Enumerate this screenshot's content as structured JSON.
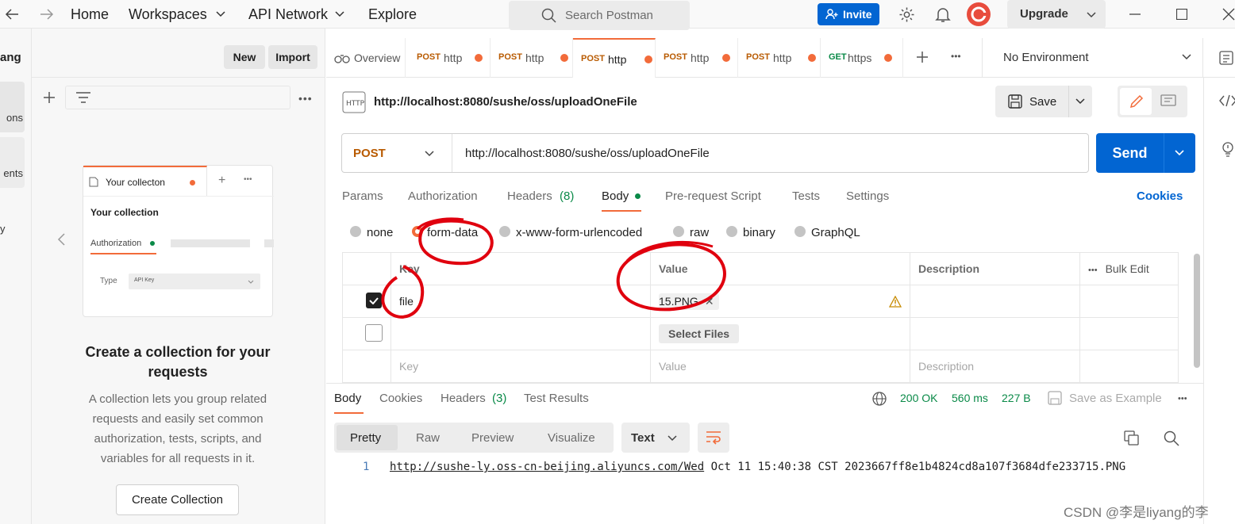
{
  "topbar": {
    "nav": [
      "Home",
      "Workspaces",
      "API Network",
      "Explore"
    ],
    "search_placeholder": "Search Postman",
    "invite_label": "Invite",
    "upgrade_label": "Upgrade"
  },
  "sidebar": {
    "workspace_name": "ang",
    "new_label": "New",
    "import_label": "Import",
    "rail_items": [
      "ons",
      "ents",
      "y"
    ],
    "illustration": {
      "tab_label": "Your collecton",
      "collection_title": "Your collection",
      "auth_label": "Authorization",
      "type_label": "Type",
      "type_value": "API Key"
    },
    "empty_title": "Create a collection for your requests",
    "empty_desc": "A collection lets you group related requests and easily set common authorization, tests, scripts, and variables for all requests in it.",
    "create_button": "Create Collection"
  },
  "tabs": [
    {
      "method": "",
      "label": "Overview"
    },
    {
      "method": "POST",
      "label": "http"
    },
    {
      "method": "POST",
      "label": "http"
    },
    {
      "method": "POST",
      "label": "http"
    },
    {
      "method": "POST",
      "label": "http"
    },
    {
      "method": "POST",
      "label": "http"
    },
    {
      "method": "GET",
      "label": "https"
    }
  ],
  "environment": "No Environment",
  "request": {
    "title_url": "http://localhost:8080/sushe/oss/uploadOneFile",
    "save_label": "Save",
    "method": "POST",
    "url": "http://localhost:8080/sushe/oss/uploadOneFile",
    "send_label": "Send",
    "subtabs": {
      "params": "Params",
      "authorization": "Authorization",
      "headers": "Headers",
      "headers_count": "(8)",
      "body": "Body",
      "prerequest": "Pre-request Script",
      "tests": "Tests",
      "settings": "Settings"
    },
    "cookies_link": "Cookies",
    "body_types": [
      "none",
      "form-data",
      "x-www-form-urlencoded",
      "raw",
      "binary",
      "GraphQL"
    ],
    "table": {
      "headers": {
        "key": "Key",
        "value": "Value",
        "description": "Description",
        "bulk": "Bulk Edit"
      },
      "row1": {
        "key": "file",
        "file": "15.PNG"
      },
      "select_files": "Select Files",
      "placeholder": {
        "key": "Key",
        "value": "Value",
        "description": "Description"
      }
    }
  },
  "response": {
    "tabs": {
      "body": "Body",
      "cookies": "Cookies",
      "headers": "Headers",
      "headers_count": "(3)",
      "tests": "Test Results"
    },
    "status": "200 OK",
    "time": "560 ms",
    "size": "227 B",
    "save_example": "Save as Example",
    "views": [
      "Pretty",
      "Raw",
      "Preview",
      "Visualize"
    ],
    "format": "Text",
    "line_number": "1",
    "url_part": "http://sushe-ly.oss-cn-beijing.aliyuncs.com/Wed",
    "rest_part": " Oct 11 15:40:38 CST 2023667ff8e1b4824cd8a107f3684dfe233715.PNG"
  },
  "watermark": "CSDN @李是liyang的李",
  "colors": {
    "primary": "#0265d2",
    "accent_orange": "#f26b3a",
    "success": "#0a8a48",
    "annotation": "#e0000e"
  }
}
